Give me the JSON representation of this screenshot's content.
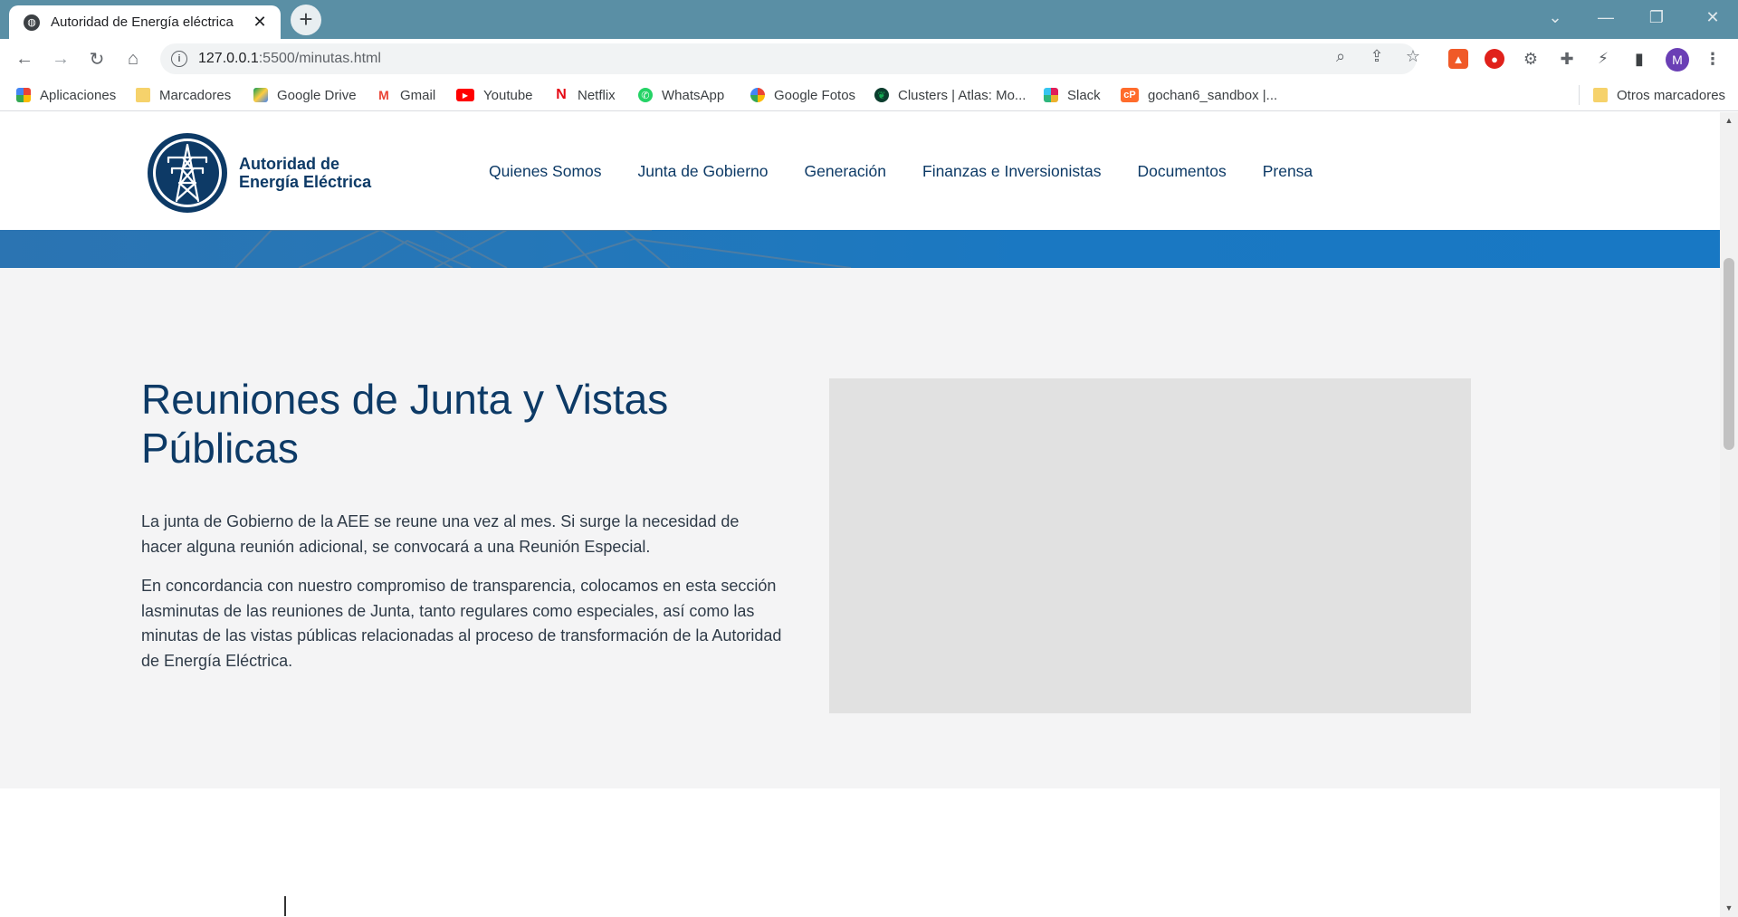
{
  "browser": {
    "tab_title": "Autoridad de Energía eléctrica",
    "tab_close": "✕",
    "new_tab": "+",
    "url_host": "127.0.0.1",
    "url_path": ":5500/minutas.html",
    "avatar_letter": "M"
  },
  "bookmarks": [
    {
      "label": "Aplicaciones"
    },
    {
      "label": "Marcadores"
    },
    {
      "label": "Google Drive"
    },
    {
      "label": "Gmail"
    },
    {
      "label": "Youtube"
    },
    {
      "label": "Netflix"
    },
    {
      "label": "WhatsApp"
    },
    {
      "label": "Google Fotos"
    },
    {
      "label": "Clusters | Atlas: Mo..."
    },
    {
      "label": "Slack"
    },
    {
      "label": "gochan6_sandbox |..."
    },
    {
      "label": "Otros marcadores"
    }
  ],
  "site": {
    "logo_line1": "Autoridad de",
    "logo_line2": "Energía Eléctrica",
    "nav": [
      {
        "label": "Quienes Somos"
      },
      {
        "label": "Junta de Gobierno"
      },
      {
        "label": "Generación"
      },
      {
        "label": "Finanzas e Inversionistas"
      },
      {
        "label": "Documentos"
      },
      {
        "label": "Prensa"
      }
    ]
  },
  "intro": {
    "heading": "Reuniones de Junta y Vistas Públicas",
    "paragraph1": "La junta de Gobierno de la AEE se reune una vez al mes. Si surge la necesidad de hacer alguna reunión adicional, se convocará a una Reunión Especial.",
    "paragraph2": "En concordancia con nuestro compromiso de transparencia, colocamos en esta sección lasminutas de las reuniones de Junta, tanto regulares como especiales, así como las minutas de las vistas públicas relacionadas al proceso de transformación de la Autoridad de Energía Eléctrica."
  },
  "colors": {
    "tabstrip": "#5a8fa5",
    "brand_navy": "#0d3a66",
    "banner_blue": "#1a78c2",
    "section_bg": "#f4f4f5",
    "placeholder_gray": "#e1e1e1"
  }
}
